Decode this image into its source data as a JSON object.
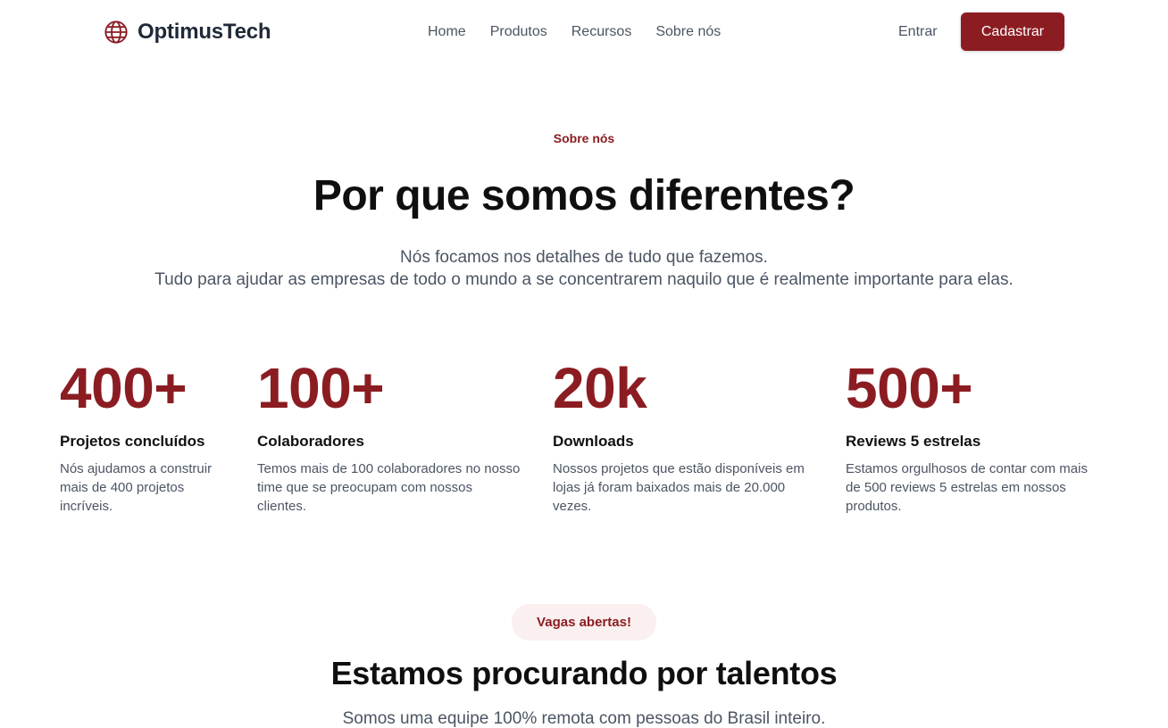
{
  "brand": {
    "name": "OptimusTech",
    "icon": "globe-icon",
    "accent_color": "#8b1d22"
  },
  "nav": {
    "links": [
      "Home",
      "Produtos",
      "Recursos",
      "Sobre nós"
    ],
    "login_label": "Entrar",
    "signup_label": "Cadastrar"
  },
  "hero": {
    "eyebrow": "Sobre nós",
    "title": "Por que somos diferentes?",
    "subtitle_line1": "Nós focamos nos detalhes de tudo que fazemos.",
    "subtitle_line2": "Tudo para ajudar as empresas de todo o mundo a se concentrarem naquilo que é realmente importante para elas."
  },
  "stats": [
    {
      "value": "400+",
      "label": "Projetos concluídos",
      "description": "Nós ajudamos a construir mais de 400 projetos incríveis."
    },
    {
      "value": "100+",
      "label": "Colaboradores",
      "description": "Temos mais de 100 colaboradores no nosso time que se preocupam com nossos clientes."
    },
    {
      "value": "20k",
      "label": "Downloads",
      "description": "Nossos projetos que estão disponíveis em lojas já foram baixados mais de 20.000 vezes."
    },
    {
      "value": "500+",
      "label": "Reviews 5 estrelas",
      "description": "Estamos orgulhosos de contar com mais de 500 reviews 5 estrelas em nossos produtos."
    }
  ],
  "careers": {
    "badge": "Vagas abertas!",
    "title": "Estamos procurando por talentos",
    "subtitle": "Somos uma equipe 100% remota com pessoas do Brasil inteiro."
  }
}
